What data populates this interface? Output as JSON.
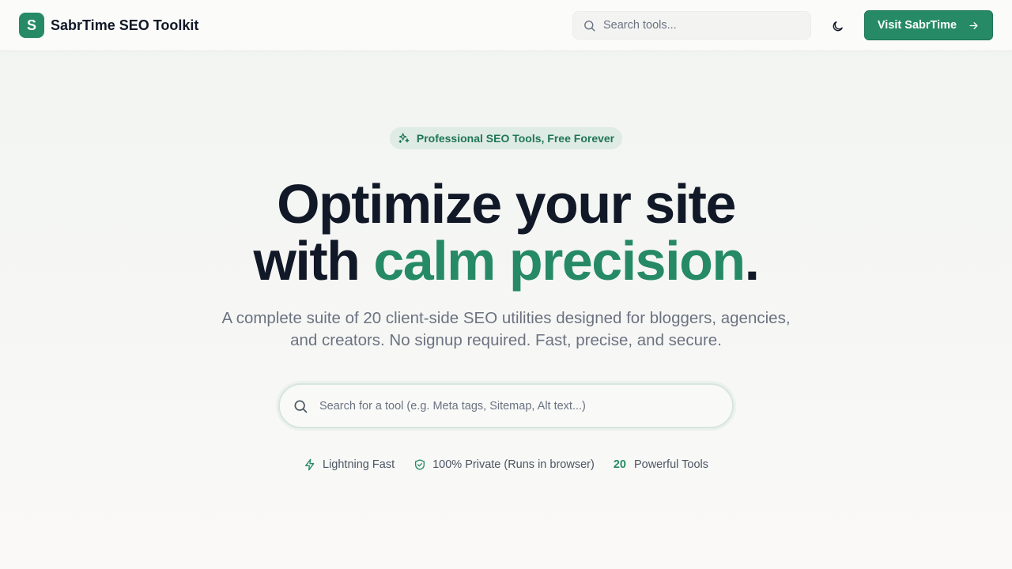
{
  "header": {
    "logo_letter": "S",
    "brand_name": "SabrTime SEO Toolkit",
    "search_placeholder": "Search tools...",
    "theme_toggle_icon": "moon-icon",
    "visit_button_label": "Visit SabrTime"
  },
  "hero": {
    "badge_text": "Professional SEO Tools, Free Forever",
    "headline_line1": "Optimize your site",
    "headline_prefix": "with ",
    "headline_accent": "calm precision",
    "headline_suffix": ".",
    "subtitle": "A complete suite of 20 client-side SEO utilities designed for bloggers, agencies, and creators. No signup required. Fast, precise, and secure.",
    "search_placeholder": "Search for a tool (e.g. Meta tags, Sitemap, Alt text...)"
  },
  "features": [
    {
      "icon": "lightning-icon",
      "label": "Lightning Fast"
    },
    {
      "icon": "shield-check-icon",
      "label": "100% Private (Runs in browser)"
    },
    {
      "count": "20",
      "label": "Powerful Tools"
    }
  ],
  "colors": {
    "accent": "#268a66",
    "text": "#111827",
    "muted": "#6b7280"
  }
}
